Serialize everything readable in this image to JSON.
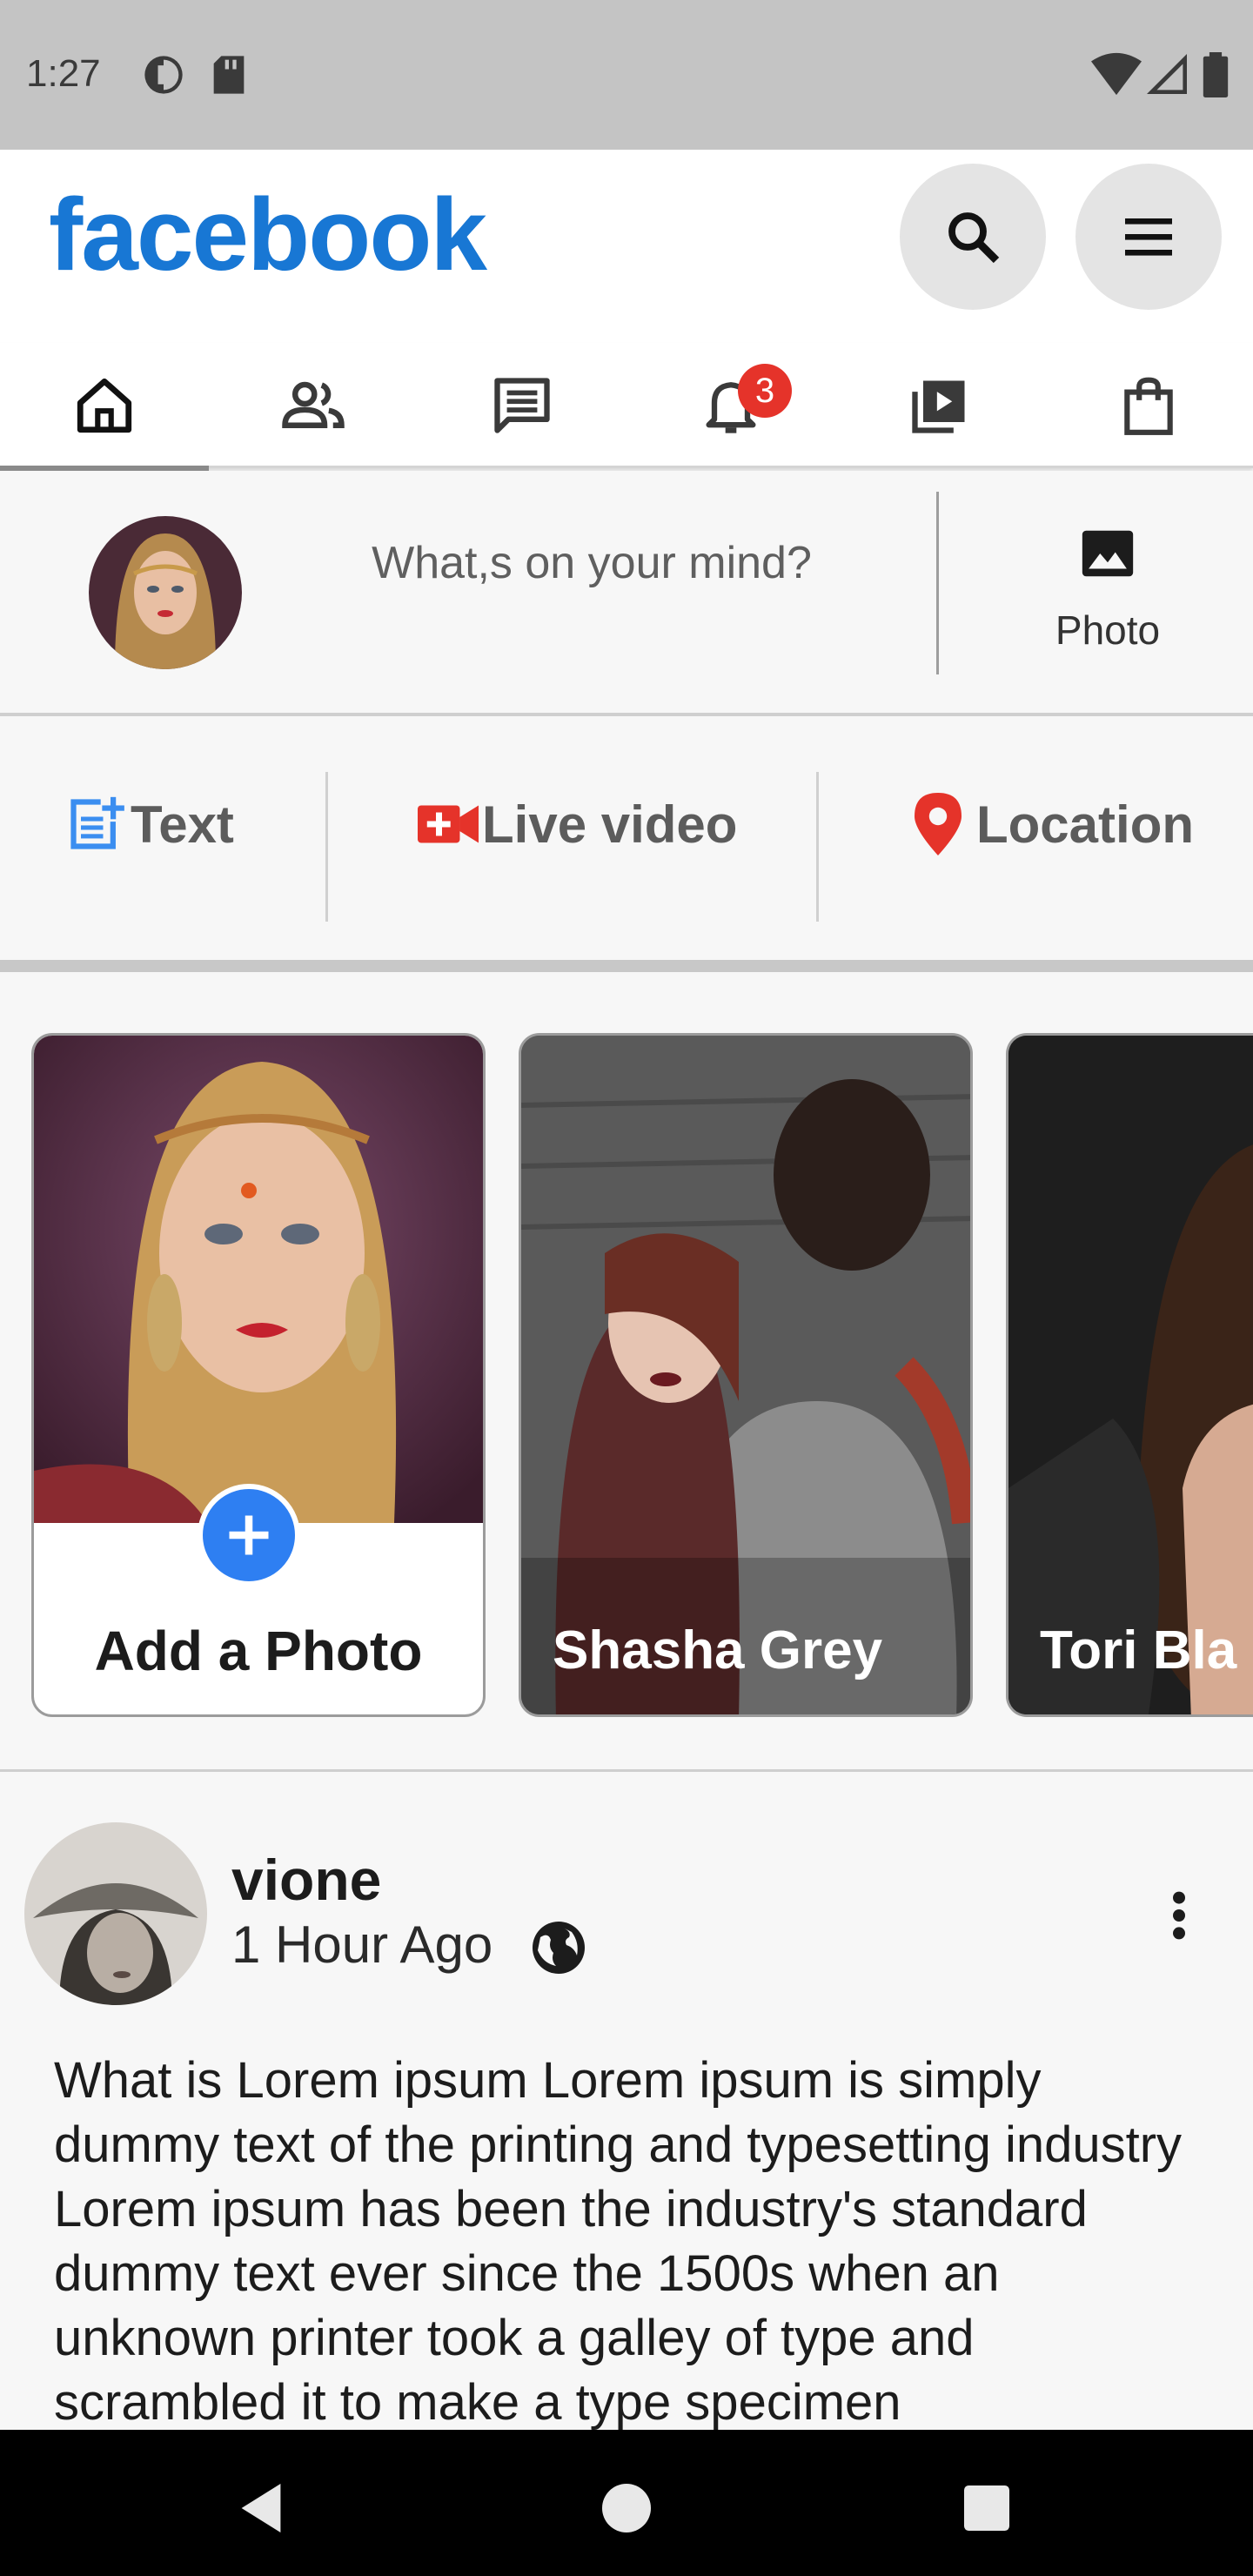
{
  "status_bar": {
    "time": "1:27",
    "icons": [
      "data-saver-icon",
      "sd-card-icon",
      "wifi-icon",
      "signal-icon",
      "battery-icon"
    ]
  },
  "header": {
    "brand": "facebook",
    "brand_color": "#1877d4",
    "search_icon": "search-icon",
    "menu_icon": "menu-icon"
  },
  "tabs": [
    {
      "icon": "home-icon",
      "selected": true
    },
    {
      "icon": "friends-icon",
      "selected": false
    },
    {
      "icon": "messages-icon",
      "selected": false
    },
    {
      "icon": "notifications-icon",
      "selected": false,
      "badge": "3"
    },
    {
      "icon": "watch-icon",
      "selected": false
    },
    {
      "icon": "marketplace-icon",
      "selected": false
    }
  ],
  "composer": {
    "placeholder": "What,s on your mind?",
    "photo_label": "Photo"
  },
  "actions": [
    {
      "label": "Text",
      "icon": "post-add-icon",
      "color": "#3b8ef0"
    },
    {
      "label": "Live video",
      "icon": "live-video-icon",
      "color": "#e5332a"
    },
    {
      "label": "Location",
      "icon": "location-pin-icon",
      "color": "#e5332a"
    }
  ],
  "stories": [
    {
      "label": "Add a Photo",
      "type": "add"
    },
    {
      "label": "Shasha Grey",
      "type": "story"
    },
    {
      "label": "Tori Bla",
      "type": "story"
    }
  ],
  "post": {
    "author": "vione",
    "time": "1 Hour Ago",
    "privacy_icon": "globe-icon",
    "text": "What is Lorem ipsum Lorem ipsum is simply dummy text of the printing and typesetting industry Lorem ipsum has been the industry's standard dummy text ever since the 1500s when an unknown printer took a galley of type and scrambled it to make a type specimen"
  },
  "nav": [
    "back-icon",
    "home-circle-icon",
    "recents-icon"
  ]
}
